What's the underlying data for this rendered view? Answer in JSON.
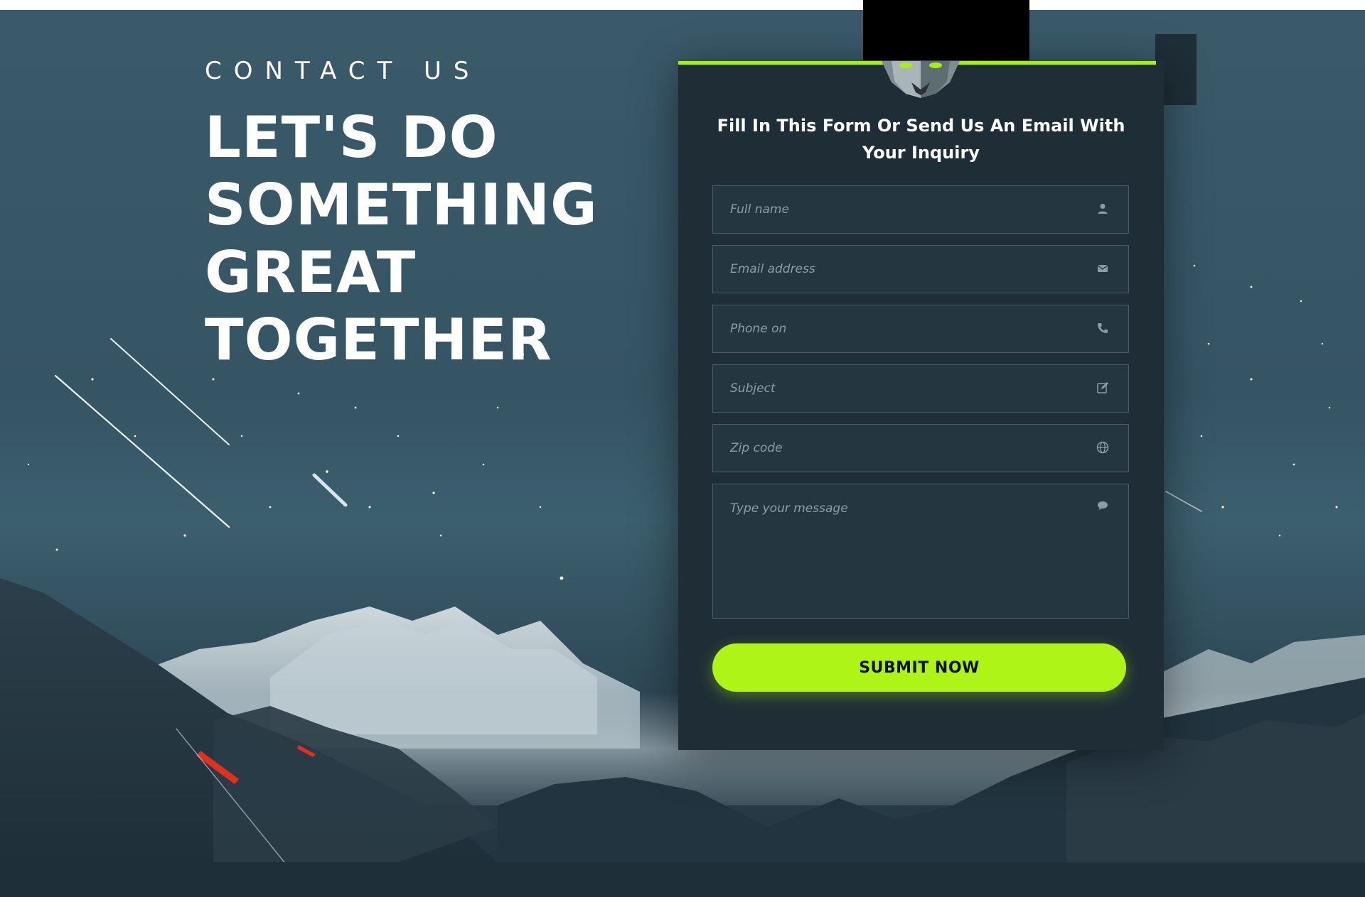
{
  "hero": {
    "eyebrow": "CONTACT US",
    "headline_lines": [
      "LET'S DO",
      "SOMETHING",
      "GREAT",
      "TOGETHER"
    ]
  },
  "form": {
    "title": "Fill In This Form Or Send Us An Email With Your Inquiry",
    "fields": [
      {
        "placeholder": "Full name",
        "value": "",
        "icon": "user-icon"
      },
      {
        "placeholder": "Email address",
        "value": "",
        "icon": "envelope-icon"
      },
      {
        "placeholder": "Phone on",
        "value": "",
        "icon": "phone-icon"
      },
      {
        "placeholder": "Subject",
        "value": "",
        "icon": "edit-icon"
      },
      {
        "placeholder": "Zip code",
        "value": "",
        "icon": "globe-icon"
      },
      {
        "placeholder": "Type your message",
        "value": "",
        "icon": "chat-bubble-icon"
      }
    ],
    "submit_label": "SUBMIT NOW"
  },
  "colors": {
    "accent": "#a8f013",
    "button": "#aef416",
    "card": "#1f2e36",
    "field_bg": "#243740",
    "field_border": "#4b5d66",
    "sky_top": "#3a5a6a",
    "bottom_band": "#1e2f39"
  }
}
